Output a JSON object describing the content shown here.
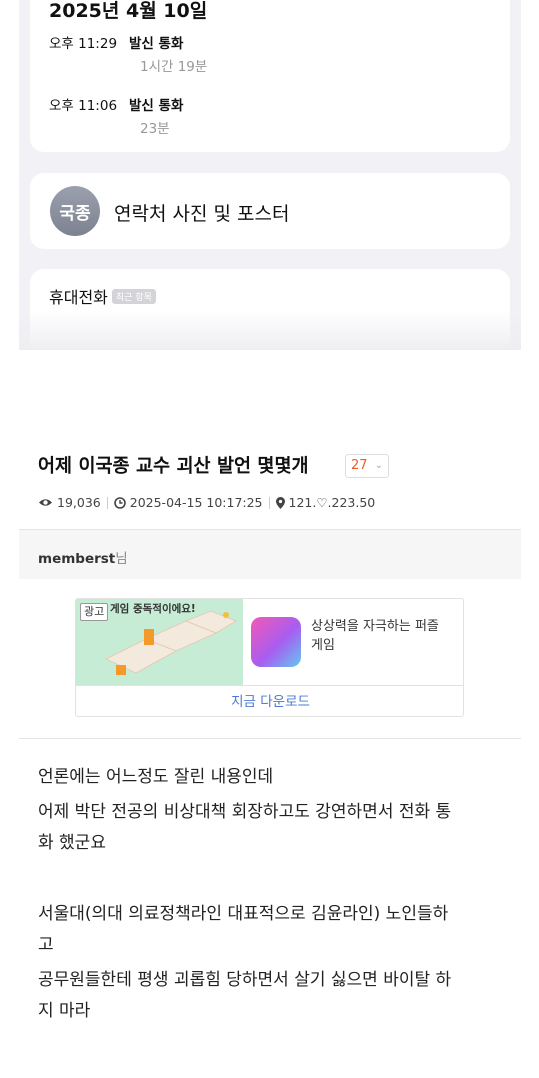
{
  "screenshot": {
    "call_date": "2025년 4월 10일",
    "calls": [
      {
        "time": "오후 11:29",
        "kind": "발신 통화",
        "duration": "1시간 19분"
      },
      {
        "time": "오후 11:06",
        "kind": "발신 통화",
        "duration": "23분"
      }
    ],
    "avatar_initials": "국종",
    "poster_label": "연락처 사진 및 포스터",
    "mobile_label": "휴대전화",
    "recent_badge": "최근 항목"
  },
  "post": {
    "title": "어제 이국종 교수 괴산 발언 몇몇개",
    "comment_count": "27",
    "views": "19,036",
    "datetime": "2025-04-15 10:17:25",
    "ip": "121.♡.223.50",
    "author": "memberst",
    "author_suffix": "님"
  },
  "ad": {
    "badge": "광고",
    "banner": "게임 중독적이에요!",
    "title": "상상력을 자극하는 퍼즐 게임",
    "cta": "지금 다운로드"
  },
  "body_lines": [
    "언론에는 어느정도 잘린 내용인데",
    "어제 박단 전공의 비상대책 회장하고도 강연하면서 전화 통",
    "화 했군요",
    "서울대(의대 의료정책라인 대표적으로 김윤라인) 노인들하",
    "고",
    "공무원들한테 평생 괴롭힘 당하면서 살기 싫으면 바이탈 하",
    "지 마라"
  ],
  "colors": {
    "accent_orange": "#e85d2a",
    "link_blue": "#4a7bd0"
  }
}
